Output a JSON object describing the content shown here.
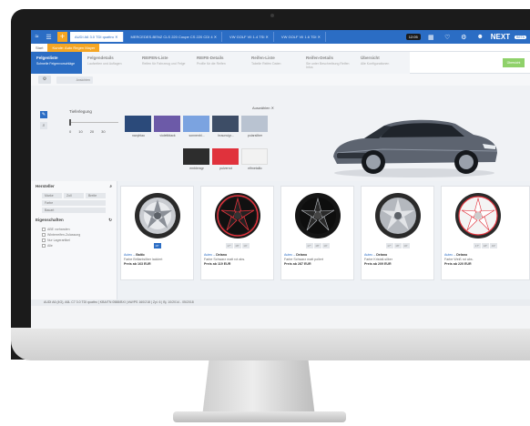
{
  "topbar": {
    "tabs": [
      {
        "label": "AUDI A6 3.0 TDI quattro",
        "active": true
      },
      {
        "label": "MERCEDES-BENZ CLS 220 Coupe CS 220 CDI 4",
        "active": false
      },
      {
        "label": "VW GOLF VII 1.4 TSI",
        "active": false
      },
      {
        "label": "VW GOLF VII 1.6 TDI",
        "active": false
      }
    ],
    "time_badge": "12:05",
    "brand": "NEXT",
    "brand_badge": "BETA"
  },
  "subbar": {
    "items": [
      "Start",
      "Kunde: Auto Regen Mayer"
    ]
  },
  "steps": [
    {
      "title": "Felgenliste",
      "sub": "Schnelle Felgenvorschläge",
      "state": "active"
    },
    {
      "title": "Felgendetails",
      "sub": "Laufzeiten und Auflagen",
      "state": "light"
    },
    {
      "title": "REIFEN-Liste",
      "sub": "Reifen für Fahrzeug und Felge",
      "state": "off"
    },
    {
      "title": "REIFE-Details",
      "sub": "Profile für die Reifen",
      "state": "off"
    },
    {
      "title": "Reifen-Liste",
      "sub": "Tabelle Reifen Daten",
      "state": "off"
    },
    {
      "title": "Reifen-Details",
      "sub": "Sie unter Beschreibung Reifen Infos",
      "state": "off"
    },
    {
      "title": "Übersicht",
      "sub": "Alle Konfigurationen",
      "state": "off"
    }
  ],
  "go_button": "Übersicht",
  "toolbar": {
    "ansicht": "Ansichten"
  },
  "config": {
    "slider_label": "Tieferlegung",
    "ticks": [
      "0",
      "10",
      "20",
      "30"
    ],
    "select_label": "Auswählen",
    "colors": [
      {
        "name": "navyblau",
        "hex": "#2b4a7a"
      },
      {
        "name": "violettblack",
        "hex": "#6c5aa8"
      },
      {
        "name": "sonnenbl...",
        "hex": "#7ba3e0"
      },
      {
        "name": "braunsigr...",
        "hex": "#3d4d66"
      },
      {
        "name": "polarsilber",
        "hex": "#b9c3d1"
      },
      {
        "name": "emblemgr",
        "hex": "#2d2d2d"
      },
      {
        "name": "pulverrot",
        "hex": "#e0323c"
      },
      {
        "name": "elfmetallic",
        "hex": "#f2f2f2"
      }
    ]
  },
  "sidebar": {
    "hersteller": "Hersteller",
    "dropdowns": [
      "Marke",
      "Zoll",
      "Breite",
      "Farbe",
      "Bauart"
    ],
    "eigenschaften": "Eigenschaften",
    "checks": [
      "ABE vorhanden",
      "Winterreifen-Zulassung",
      "Nur Lagerartikel",
      "Alle"
    ]
  },
  "products": [
    {
      "brand": "Autec",
      "model": "Baltic",
      "desc": "Farbe Brillantsilber lackiert",
      "price": "Preis ab 163 EUR",
      "rim": "silver"
    },
    {
      "brand": "Autec",
      "model": "Delano",
      "desc": "Farbe Schwarz matt rot abs.",
      "price": "Preis ab 119 EUR",
      "rim": "red"
    },
    {
      "brand": "Autec",
      "model": "Delano",
      "desc": "Farbe Schwarz matt poliert",
      "price": "Preis ab 287 EUR",
      "rim": "black"
    },
    {
      "brand": "Autec",
      "model": "Delano",
      "desc": "Farbe Kristall-silber",
      "price": "Preis ab 209 EUR",
      "rim": "silver"
    },
    {
      "brand": "Autec",
      "model": "Delano",
      "desc": "Farbe Weiß rot abs.",
      "price": "Preis ab 220 EUR",
      "rim": "white"
    }
  ],
  "status_bar": "AUDI A6 (4G), A6L C7 3.0 TDI quattro | KBA/TN 0588/BXI | kW/PS 160/218 | Zyl. 6 | Bj. 10/2014 - 05/2018"
}
